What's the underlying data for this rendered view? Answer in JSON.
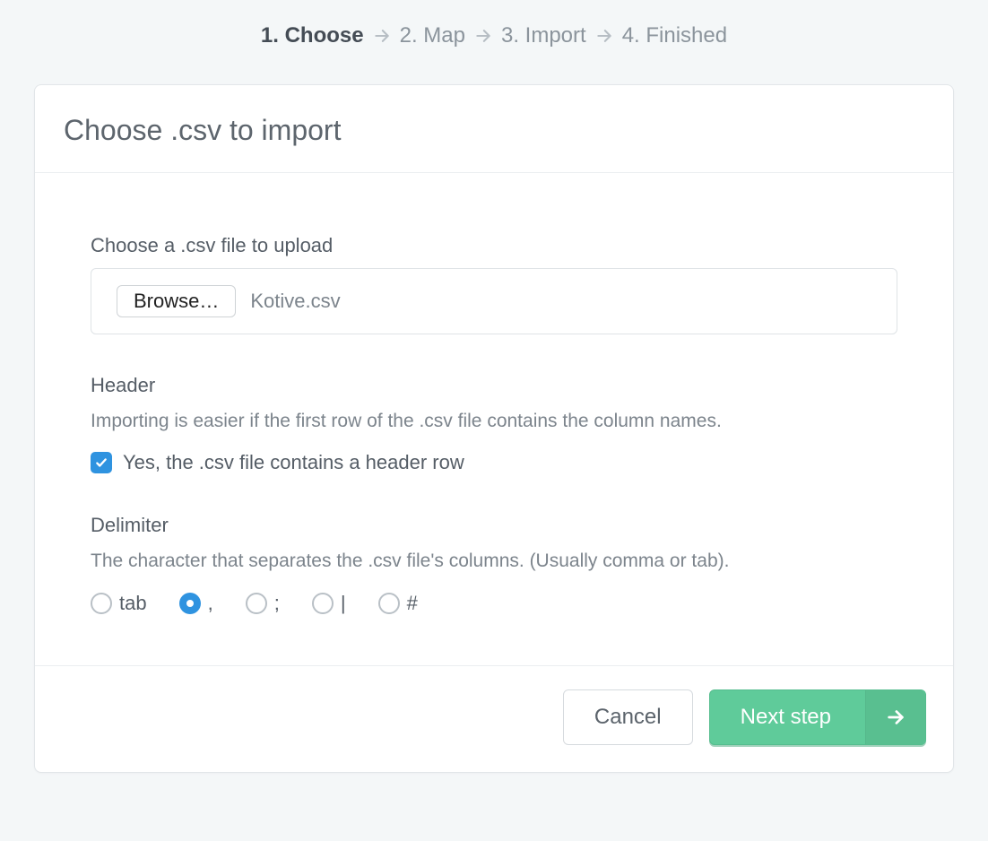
{
  "steps": [
    {
      "label": "1. Choose",
      "active": true
    },
    {
      "label": "2. Map",
      "active": false
    },
    {
      "label": "3. Import",
      "active": false
    },
    {
      "label": "4. Finished",
      "active": false
    }
  ],
  "card": {
    "title": "Choose .csv to import"
  },
  "file": {
    "label": "Choose a .csv file to upload",
    "browse_label": "Browse…",
    "selected_name": "Kotive.csv"
  },
  "header_opt": {
    "title": "Header",
    "help": "Importing is easier if the first row of the .csv file contains the column names.",
    "checkbox_label": "Yes, the .csv file contains a header row",
    "checked": true
  },
  "delimiter": {
    "title": "Delimiter",
    "help": "The character that separates the .csv file's columns. (Usually comma or tab).",
    "selected": ",",
    "options": [
      {
        "label": "tab",
        "value": "tab"
      },
      {
        "label": ",",
        "value": ","
      },
      {
        "label": ";",
        "value": ";"
      },
      {
        "label": "|",
        "value": "|"
      },
      {
        "label": "#",
        "value": "#"
      }
    ]
  },
  "footer": {
    "cancel_label": "Cancel",
    "next_label": "Next step"
  },
  "colors": {
    "accent_blue": "#2f93e0",
    "accent_green": "#5fcb9a"
  }
}
